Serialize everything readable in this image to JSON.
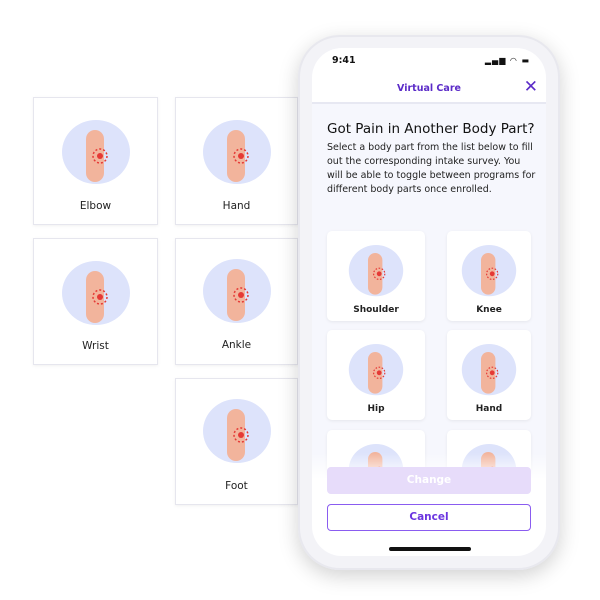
{
  "side_cards": [
    {
      "label": "Elbow"
    },
    {
      "label": "Hand"
    },
    {
      "label": "Wrist"
    },
    {
      "label": "Ankle"
    },
    {
      "label": "Foot"
    }
  ],
  "phone": {
    "time": "9:41",
    "status_icons": [
      "signal-icon",
      "wifi-icon",
      "battery-icon"
    ],
    "header_title": "Virtual Care",
    "title": "Got Pain in Another Body Part?",
    "description": "Select a body part from the list below to fill out the corresponding intake survey. You will be able to toggle between programs for different body parts once enrolled.",
    "body_parts": [
      {
        "label": "Shoulder"
      },
      {
        "label": "Knee"
      },
      {
        "label": "Hip"
      },
      {
        "label": "Hand"
      },
      {
        "label": ""
      },
      {
        "label": ""
      }
    ],
    "change_label": "Change",
    "cancel_label": "Cancel"
  },
  "colors": {
    "accent": "#5b2bc8",
    "blob": "#dde3fb",
    "pain": "#e53935",
    "skin": "#f2b49c"
  }
}
